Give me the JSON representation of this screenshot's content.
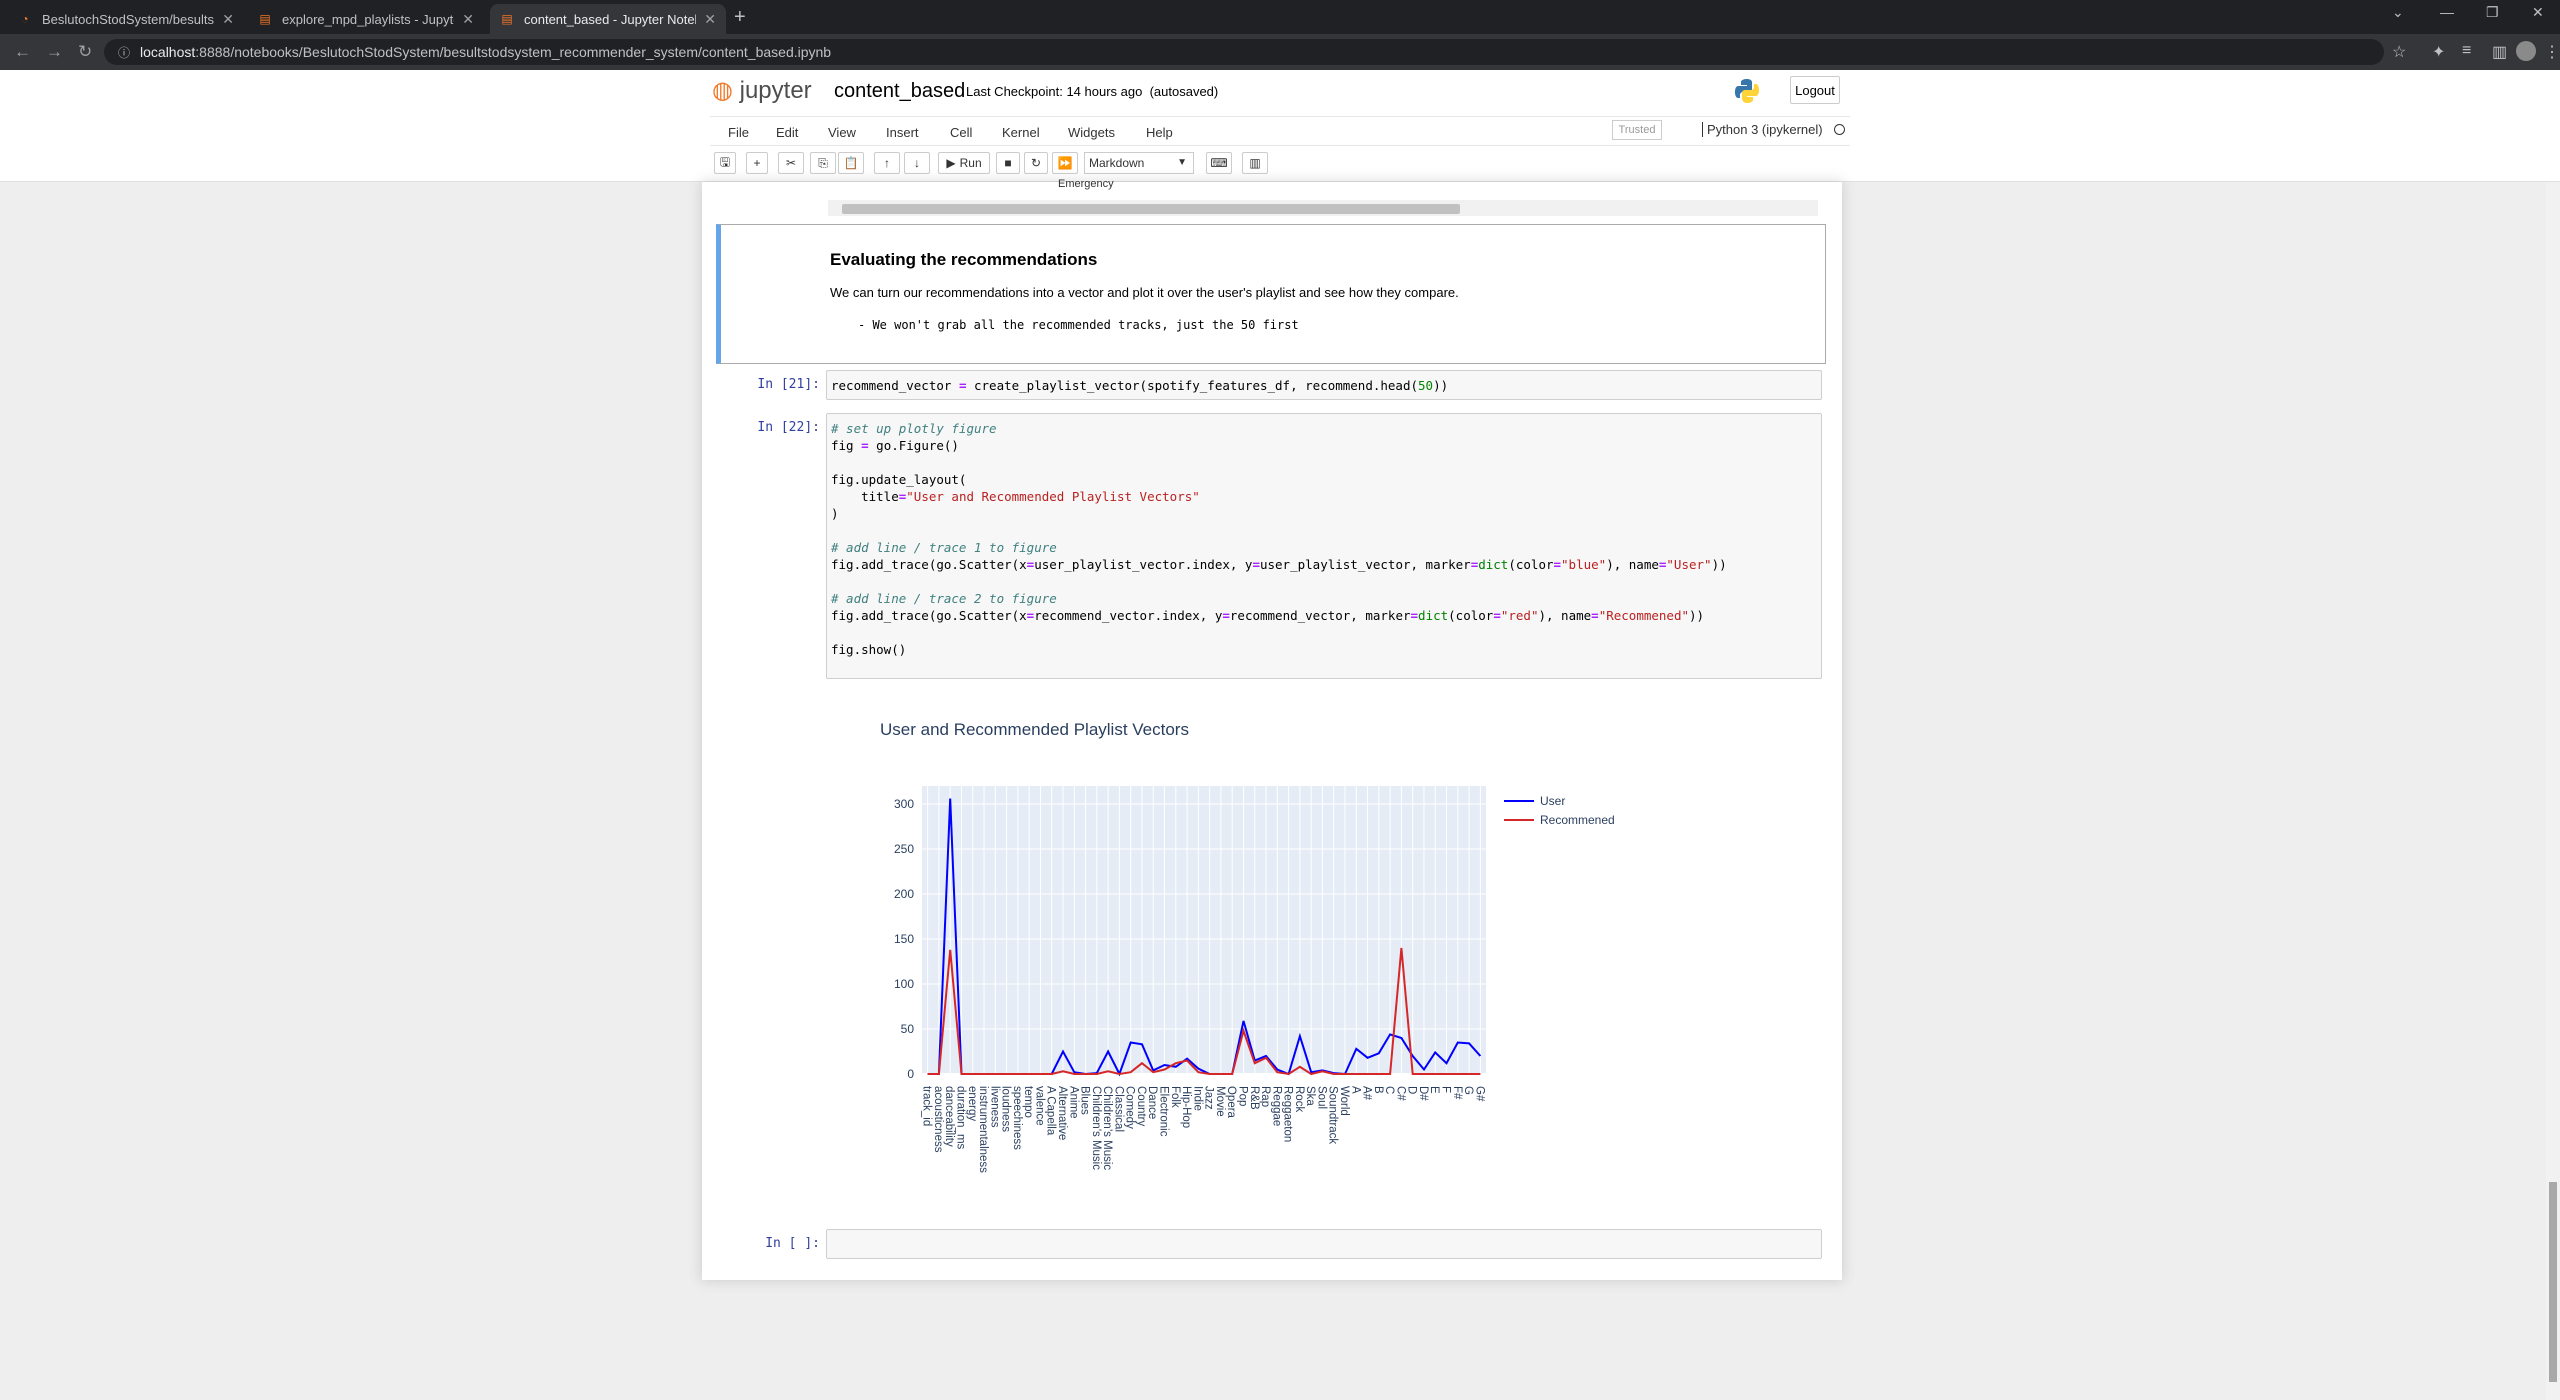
{
  "browser": {
    "tabs": [
      {
        "title": "BeslutochStodSystem/besultstod",
        "active": false
      },
      {
        "title": "explore_mpd_playlists - Jupyter N",
        "active": false
      },
      {
        "title": "content_based - Jupyter Notebo",
        "active": true
      }
    ],
    "url_host": "localhost",
    "url_path": ":8888/notebooks/BeslutochStodSystem/besultstodsystem_recommender_system/content_based.ipynb"
  },
  "jupyter": {
    "logo": "jupyter",
    "notebook_name": "content_based",
    "checkpoint": "Last Checkpoint: 14 hours ago",
    "autosaved": "(autosaved)",
    "logout": "Logout",
    "menus": [
      "File",
      "Edit",
      "View",
      "Insert",
      "Cell",
      "Kernel",
      "Widgets",
      "Help"
    ],
    "trusted": "Trusted",
    "kernel": "Python 3 (ipykernel)",
    "toolbar": {
      "run": "Run",
      "cell_type": "Markdown"
    }
  },
  "cells": {
    "prev_output_tail": "Emergency",
    "markdown": {
      "heading": "Evaluating the recommendations",
      "paragraph": "We can turn our recommendations into a vector and plot it over the user's playlist and see how they compare.",
      "bullet": "- We won't grab all the recommended tracks, just the 50 first"
    },
    "cell21": {
      "prompt": "In [21]:"
    },
    "cell22": {
      "prompt": "In [22]:"
    },
    "empty": {
      "prompt": "In [ ]:"
    }
  },
  "chart_data": {
    "type": "line",
    "title": "User and Recommended Playlist Vectors",
    "ylim": [
      0,
      320
    ],
    "yticks": [
      0,
      50,
      100,
      150,
      200,
      250,
      300
    ],
    "grid": true,
    "legend_position": "top-right",
    "categories": [
      "track_id",
      "acousticness",
      "danceability",
      "duration_ms",
      "energy",
      "instrumentalness",
      "liveness",
      "loudness",
      "speechiness",
      "tempo",
      "valence",
      "A Capella",
      "Alternative",
      "Anime",
      "Blues",
      "Children's Music",
      "Children’s Music",
      "Classical",
      "Comedy",
      "Country",
      "Dance",
      "Electronic",
      "Folk",
      "Hip-Hop",
      "Indie",
      "Jazz",
      "Movie",
      "Opera",
      "Pop",
      "R&B",
      "Rap",
      "Reggae",
      "Reggaeton",
      "Rock",
      "Ska",
      "Soul",
      "Soundtrack",
      "World",
      "A",
      "A#",
      "B",
      "C",
      "C#",
      "D",
      "D#",
      "E",
      "F",
      "F#",
      "G",
      "G#"
    ],
    "series": [
      {
        "name": "User",
        "color": "#0000ff",
        "values": [
          0,
          0,
          306,
          0,
          0,
          0,
          0,
          0,
          0,
          0,
          0,
          0,
          25,
          2,
          0,
          1,
          25,
          0,
          35,
          33,
          4,
          10,
          8,
          17,
          6,
          0,
          0,
          0,
          59,
          15,
          20,
          5,
          0,
          42,
          2,
          4,
          1,
          0,
          28,
          18,
          23,
          44,
          40,
          20,
          5,
          24,
          12,
          35,
          34,
          20
        ]
      },
      {
        "name": "Recommened",
        "color": "#d62728",
        "values": [
          0,
          0,
          138,
          0,
          0,
          0,
          0,
          0,
          0,
          0,
          0,
          0,
          3,
          0,
          0,
          0,
          3,
          0,
          2,
          12,
          2,
          5,
          12,
          15,
          2,
          0,
          0,
          0,
          48,
          12,
          18,
          2,
          0,
          8,
          0,
          3,
          0,
          0,
          0,
          0,
          0,
          0,
          140,
          0,
          0,
          0,
          0,
          0,
          0,
          0
        ]
      }
    ]
  }
}
